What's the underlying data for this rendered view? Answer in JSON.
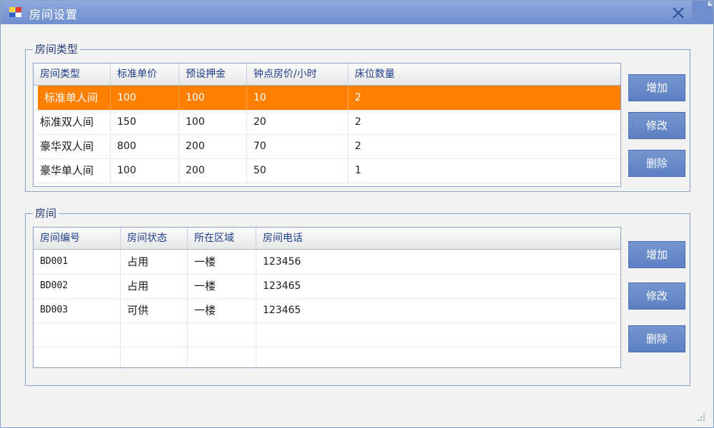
{
  "window": {
    "title": "房间设置"
  },
  "room_types": {
    "legend": "房间类型",
    "columns": [
      "房间类型",
      "标准单价",
      "预设押金",
      "钟点房价/小时",
      "床位数量"
    ],
    "rows": [
      [
        "标准单人间",
        "100",
        "100",
        "10",
        "2"
      ],
      [
        "标准双人间",
        "150",
        "100",
        "20",
        "2"
      ],
      [
        "豪华双人间",
        "800",
        "200",
        "70",
        "2"
      ],
      [
        "豪华单人间",
        "100",
        "200",
        "50",
        "1"
      ]
    ],
    "selected_row": 0,
    "buttons": {
      "add": "增加",
      "edit": "修改",
      "delete": "删除"
    }
  },
  "rooms": {
    "legend": "房间",
    "columns": [
      "房间编号",
      "房间状态",
      "所在区域",
      "房间电话"
    ],
    "rows": [
      [
        "BD001",
        "占用",
        "一楼",
        "123456"
      ],
      [
        "BD002",
        "占用",
        "一楼",
        "123465"
      ],
      [
        "BD003",
        "可供",
        "一楼",
        "123465"
      ]
    ],
    "buttons": {
      "add": "增加",
      "edit": "修改",
      "delete": "删除"
    }
  },
  "colors": {
    "titlebar": "#7b98d4",
    "selection": "#ff8000",
    "button": "#6a8bcb",
    "header_text": "#1f3f8a"
  },
  "icons": {
    "app": "app-icon",
    "close": "close-icon",
    "grip": "resize-grip-icon"
  }
}
